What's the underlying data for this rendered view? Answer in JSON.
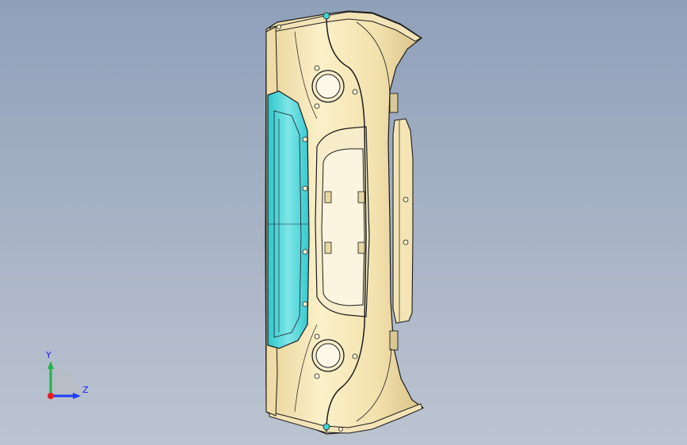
{
  "viewport": {
    "background_top": "#8fa0ba",
    "background_bottom": "#bcc4d1"
  },
  "model": {
    "part_color": "#f6e7b6",
    "edge_color": "#1c1c1c",
    "glass_color": "#43d3d6",
    "icon": "bumper-part-icon"
  },
  "triad": {
    "y_label": "Y",
    "z_label": "Z",
    "y_color": "#22b14c",
    "z_color": "#1e3cff",
    "x_color": "#e81c1c"
  }
}
